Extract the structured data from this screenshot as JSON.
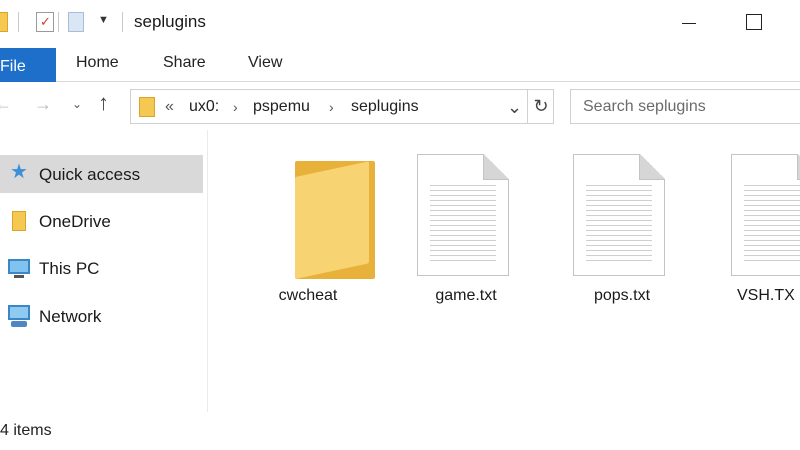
{
  "window": {
    "title": "seplugins"
  },
  "ribbon": {
    "tabs": [
      "File",
      "Home",
      "Share",
      "View"
    ]
  },
  "address": {
    "overflow": "«",
    "path": [
      "ux0:",
      "pspemu",
      "seplugins"
    ]
  },
  "search": {
    "placeholder": "Search seplugins"
  },
  "nav": {
    "items": [
      {
        "label": "Quick access",
        "icon": "star-icon",
        "selected": true
      },
      {
        "label": "OneDrive",
        "icon": "onedrive-folder-icon",
        "selected": false
      },
      {
        "label": "This PC",
        "icon": "computer-icon",
        "selected": false
      },
      {
        "label": "Network",
        "icon": "network-icon",
        "selected": false
      }
    ]
  },
  "files": [
    {
      "name": "cwcheat",
      "type": "folder"
    },
    {
      "name": "game.txt",
      "type": "text"
    },
    {
      "name": "pops.txt",
      "type": "text"
    },
    {
      "name": "VSH.TX",
      "type": "text"
    }
  ],
  "status": {
    "items": "4 items"
  },
  "colors": {
    "accent": "#1e6fc9",
    "selection": "#d9d9d9",
    "folder": "#f8d371"
  }
}
